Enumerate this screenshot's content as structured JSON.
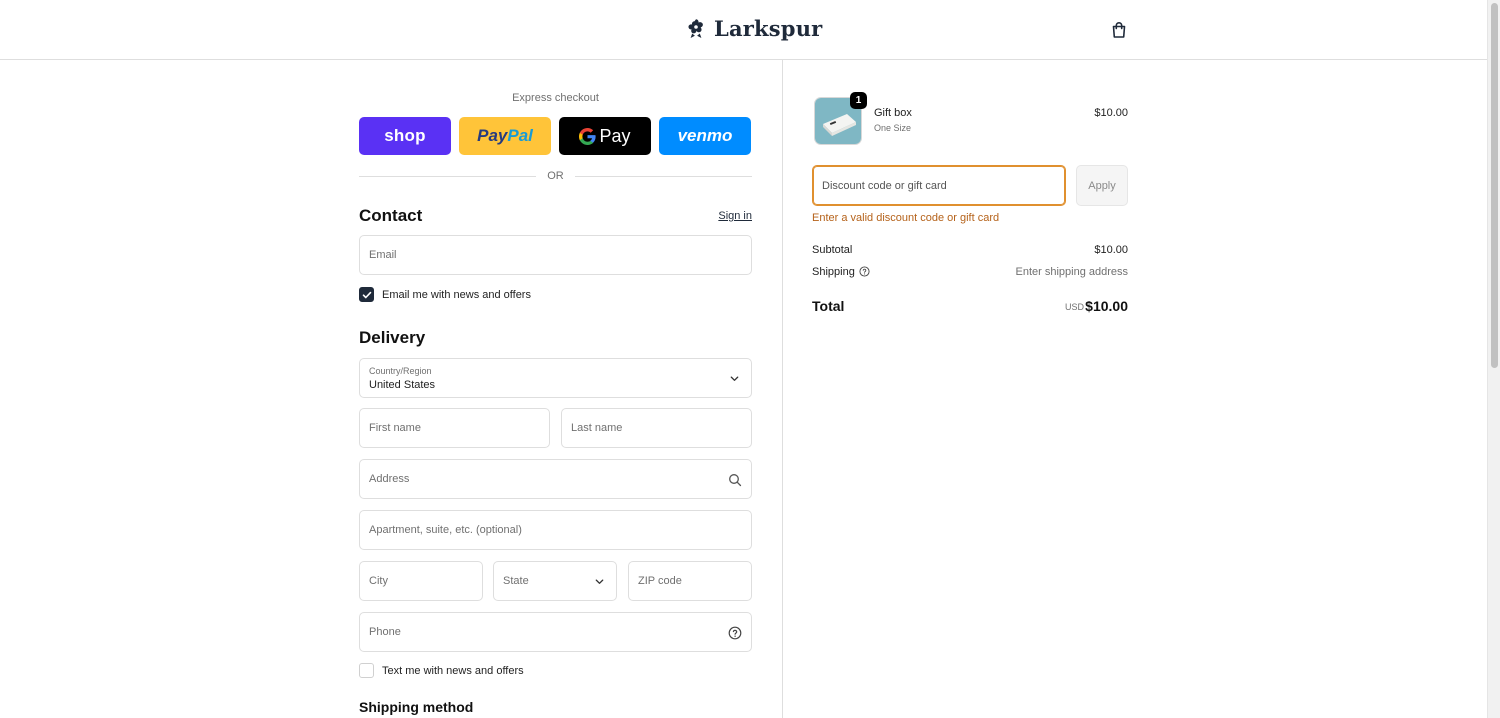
{
  "header": {
    "brand": "Larkspur",
    "cart_icon": "shopping-bag-icon"
  },
  "express": {
    "title": "Express checkout",
    "shop_label": "shop",
    "paypal_part1": "Pay",
    "paypal_part2": "Pal",
    "gpay_label": "Pay",
    "venmo_label": "venmo",
    "or_label": "OR"
  },
  "contact": {
    "heading": "Contact",
    "sign_in": "Sign in",
    "email_placeholder": "Email",
    "news_label": "Email me with news and offers",
    "news_checked": true
  },
  "delivery": {
    "heading": "Delivery",
    "country_label": "Country/Region",
    "country_value": "United States",
    "first_name_placeholder": "First name",
    "last_name_placeholder": "Last name",
    "address_placeholder": "Address",
    "apartment_placeholder": "Apartment, suite, etc. (optional)",
    "city_placeholder": "City",
    "state_label": "State",
    "zip_placeholder": "ZIP code",
    "phone_placeholder": "Phone",
    "text_label": "Text me with news and offers",
    "text_checked": false
  },
  "shipping_method": {
    "heading": "Shipping method"
  },
  "summary": {
    "item": {
      "quantity": "1",
      "name": "Gift box",
      "variant": "One Size",
      "price": "$10.00"
    },
    "discount_placeholder": "Discount code or gift card",
    "apply_label": "Apply",
    "error": "Enter a valid discount code or gift card",
    "subtotal_label": "Subtotal",
    "subtotal_value": "$10.00",
    "shipping_label": "Shipping",
    "shipping_value": "Enter shipping address",
    "total_label": "Total",
    "total_currency": "USD",
    "total_value": "$10.00"
  },
  "colors": {
    "shop": "#5a31f4",
    "paypal": "#ffc439",
    "gpay": "#000000",
    "venmo": "#008cff",
    "error_accent": "#e0902f"
  }
}
